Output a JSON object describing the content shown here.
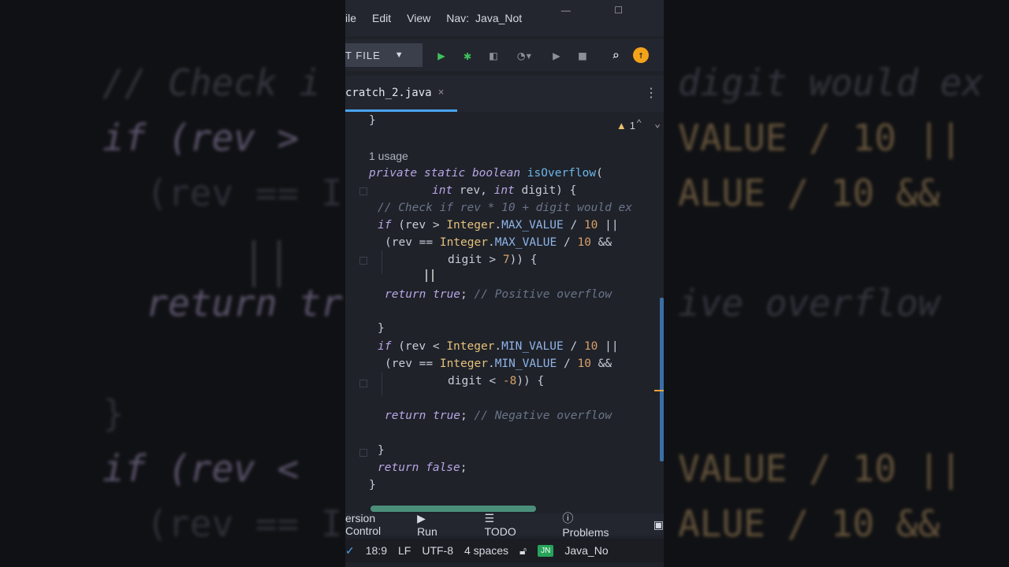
{
  "menu": {
    "file": "ile",
    "edit": "Edit",
    "view": "View",
    "nav": "Nav:",
    "project": "Java_Not"
  },
  "toolbar": {
    "run_config": "T FILE"
  },
  "tab": {
    "filename": "cratch_2.java",
    "close": "×"
  },
  "editor": {
    "warning_count": "1",
    "usage_hint": "1 usage",
    "lines": [
      {
        "kind": "brace_close_top",
        "text": "}"
      },
      {
        "kind": "sig1",
        "text": "private static boolean isOverflow("
      },
      {
        "kind": "sig2",
        "text": "int rev, int digit) {"
      },
      {
        "kind": "comment",
        "text": "// Check if rev * 10 + digit would ex"
      },
      {
        "kind": "if1",
        "text": "if (rev > Integer.MAX_VALUE / 10 ||"
      },
      {
        "kind": "cond1",
        "text": "(rev == Integer.MAX_VALUE / 10 &&"
      },
      {
        "kind": "digit1",
        "text": "digit > 7)) {"
      },
      {
        "kind": "ret1",
        "text": "return true; // Positive overflow"
      },
      {
        "kind": "close1",
        "text": "}"
      },
      {
        "kind": "if2",
        "text": "if (rev < Integer.MIN_VALUE / 10 ||"
      },
      {
        "kind": "cond2",
        "text": "(rev == Integer.MIN_VALUE / 10 &&"
      },
      {
        "kind": "digit2",
        "text": "digit < -8)) {"
      },
      {
        "kind": "ret2",
        "text": "return true; // Negative overflow"
      },
      {
        "kind": "close2",
        "text": "}"
      },
      {
        "kind": "retf",
        "text": "return false;"
      },
      {
        "kind": "close3",
        "text": "}"
      }
    ]
  },
  "tool_windows": {
    "vcs": "ersion Control",
    "run": "Run",
    "todo": "TODO",
    "problems": "Problems"
  },
  "status": {
    "position": "18:9",
    "line_sep": "LF",
    "encoding": "UTF-8",
    "indent": "4 spaces",
    "badge": "JN",
    "project": "Java_No"
  },
  "background": {
    "left_lines": [
      "// Check i",
      "if (rev >",
      "  (rev == I",
      "",
      "  return tr",
      "",
      "}",
      "if (rev <",
      "  (rev == I"
    ],
    "right_lines": [
      "digit would ex",
      "VALUE / 10 ||",
      "ALUE / 10 &&",
      "",
      "ive overflow",
      "",
      "",
      "VALUE / 10 ||",
      "ALUE / 10 &&"
    ]
  },
  "colors": {
    "accent": "#4aa3f0",
    "run_green": "#3fbf5b",
    "update": "#f2a31a"
  }
}
